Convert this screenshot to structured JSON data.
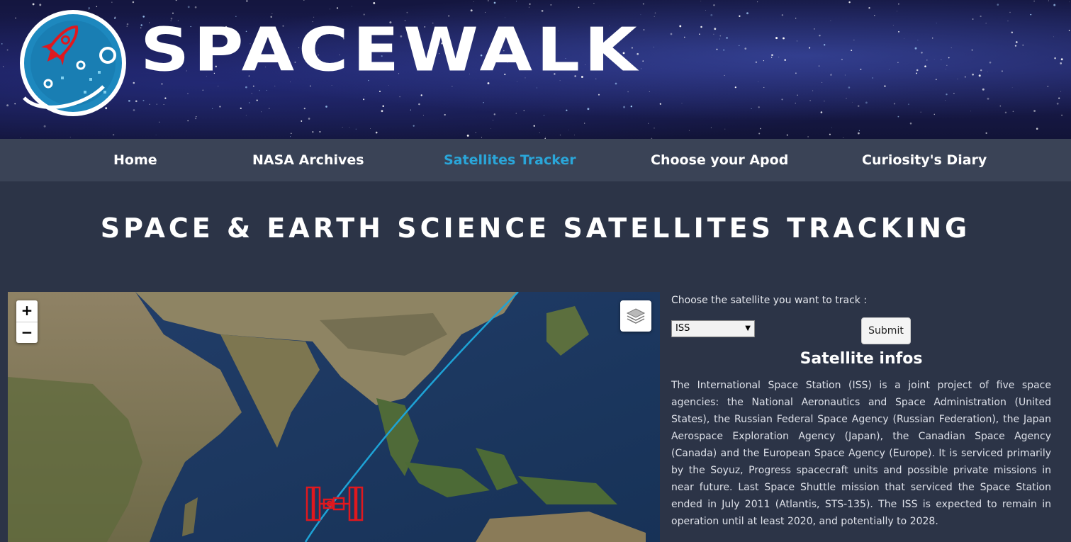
{
  "brand": {
    "name": "SPACEWALK"
  },
  "nav": {
    "items": [
      {
        "label": "Home"
      },
      {
        "label": "NASA Archives"
      },
      {
        "label": "Satellites Tracker"
      },
      {
        "label": "Choose your Apod"
      },
      {
        "label": "Curiosity's Diary"
      }
    ],
    "active_index": 2
  },
  "page": {
    "title": "Space & Earth Science Satellites Tracking"
  },
  "map": {
    "zoom_in_label": "+",
    "zoom_out_label": "−",
    "layers_icon": "layers-icon",
    "satellite_icon": "iss-icon",
    "track_color": "#1ea3d6"
  },
  "panel": {
    "choose_label": "Choose the satellite you want to track :",
    "select_value": "ISS",
    "submit_label": "Submit",
    "infos_title": "Satellite infos",
    "infos_text": "The International Space Station (ISS) is a joint project of five space agencies: the National Aeronautics and Space Administration (United States), the Russian Federal Space Agency (Russian Federation), the Japan Aerospace Exploration Agency (Japan), the Canadian Space Agency (Canada) and the European Space Agency (Europe). It is serviced primarily by the Soyuz, Progress spacecraft units and possible private missions in near future. Last Space Shuttle mission that serviced the Space Station ended in July 2011 (Atlantis, STS-135). The ISS is expected to remain in operation until at least 2020, and potentially to 2028."
  },
  "colors": {
    "background": "#2c3447",
    "nav_background": "#3a4356",
    "nav_active": "#2aa6d9",
    "logo_red": "#e0181e",
    "logo_blue": "#1f8fc4"
  }
}
